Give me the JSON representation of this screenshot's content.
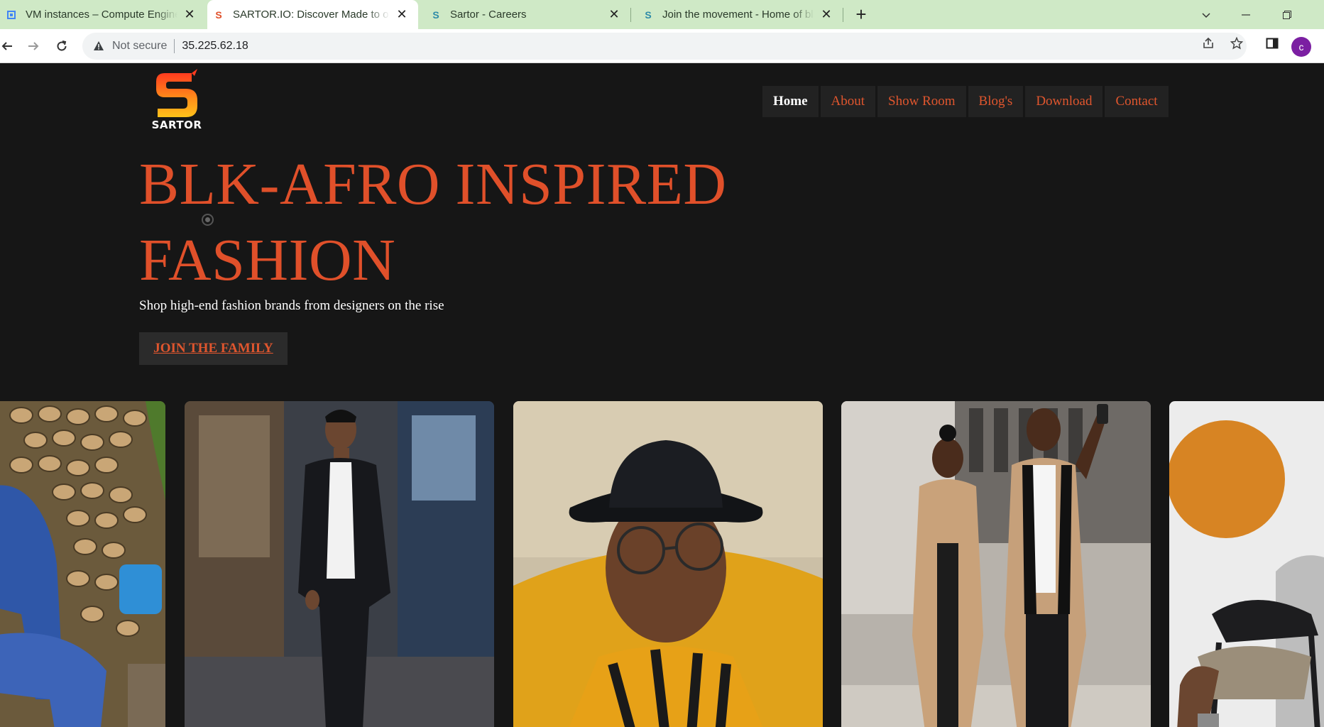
{
  "browser": {
    "tabs": [
      {
        "title": "VM instances – Compute Engine",
        "icon": "gcp-compute-icon",
        "active": false
      },
      {
        "title": "SARTOR.IO: Discover Made to order",
        "icon": "sartor-favicon",
        "active": true
      },
      {
        "title": "Sartor - Careers",
        "icon": "sartor-careers-favicon",
        "active": false
      },
      {
        "title": "Join the movement - Home of black",
        "icon": "sartor-careers-favicon",
        "active": false
      }
    ],
    "address": {
      "security_label": "Not secure",
      "url": "35.225.62.18"
    },
    "profile_initial": "c"
  },
  "site": {
    "logo_text": "SARTOR",
    "nav": [
      {
        "label": "Home",
        "active": true
      },
      {
        "label": "About",
        "active": false
      },
      {
        "label": "Show Room",
        "active": false
      },
      {
        "label": "Blog's",
        "active": false
      },
      {
        "label": "Download",
        "active": false
      },
      {
        "label": "Contact",
        "active": false
      }
    ],
    "hero": {
      "title_line1": "BLK-AFRO INSPIRED",
      "title_line2": "FASHION",
      "subtitle": "Shop high-end fashion brands from designers on the rise",
      "cta": "JOIN THE FAMILY"
    },
    "gallery": [
      {
        "name": "model-blue-suit-photo"
      },
      {
        "name": "model-black-suit-photo"
      },
      {
        "name": "model-hat-glasses-photo"
      },
      {
        "name": "couple-camel-coats-photo"
      },
      {
        "name": "model-chair-orange-circle-photo"
      }
    ],
    "colors": {
      "accent": "#e0502a",
      "background": "#161616",
      "nav_bg": "#222222"
    }
  }
}
